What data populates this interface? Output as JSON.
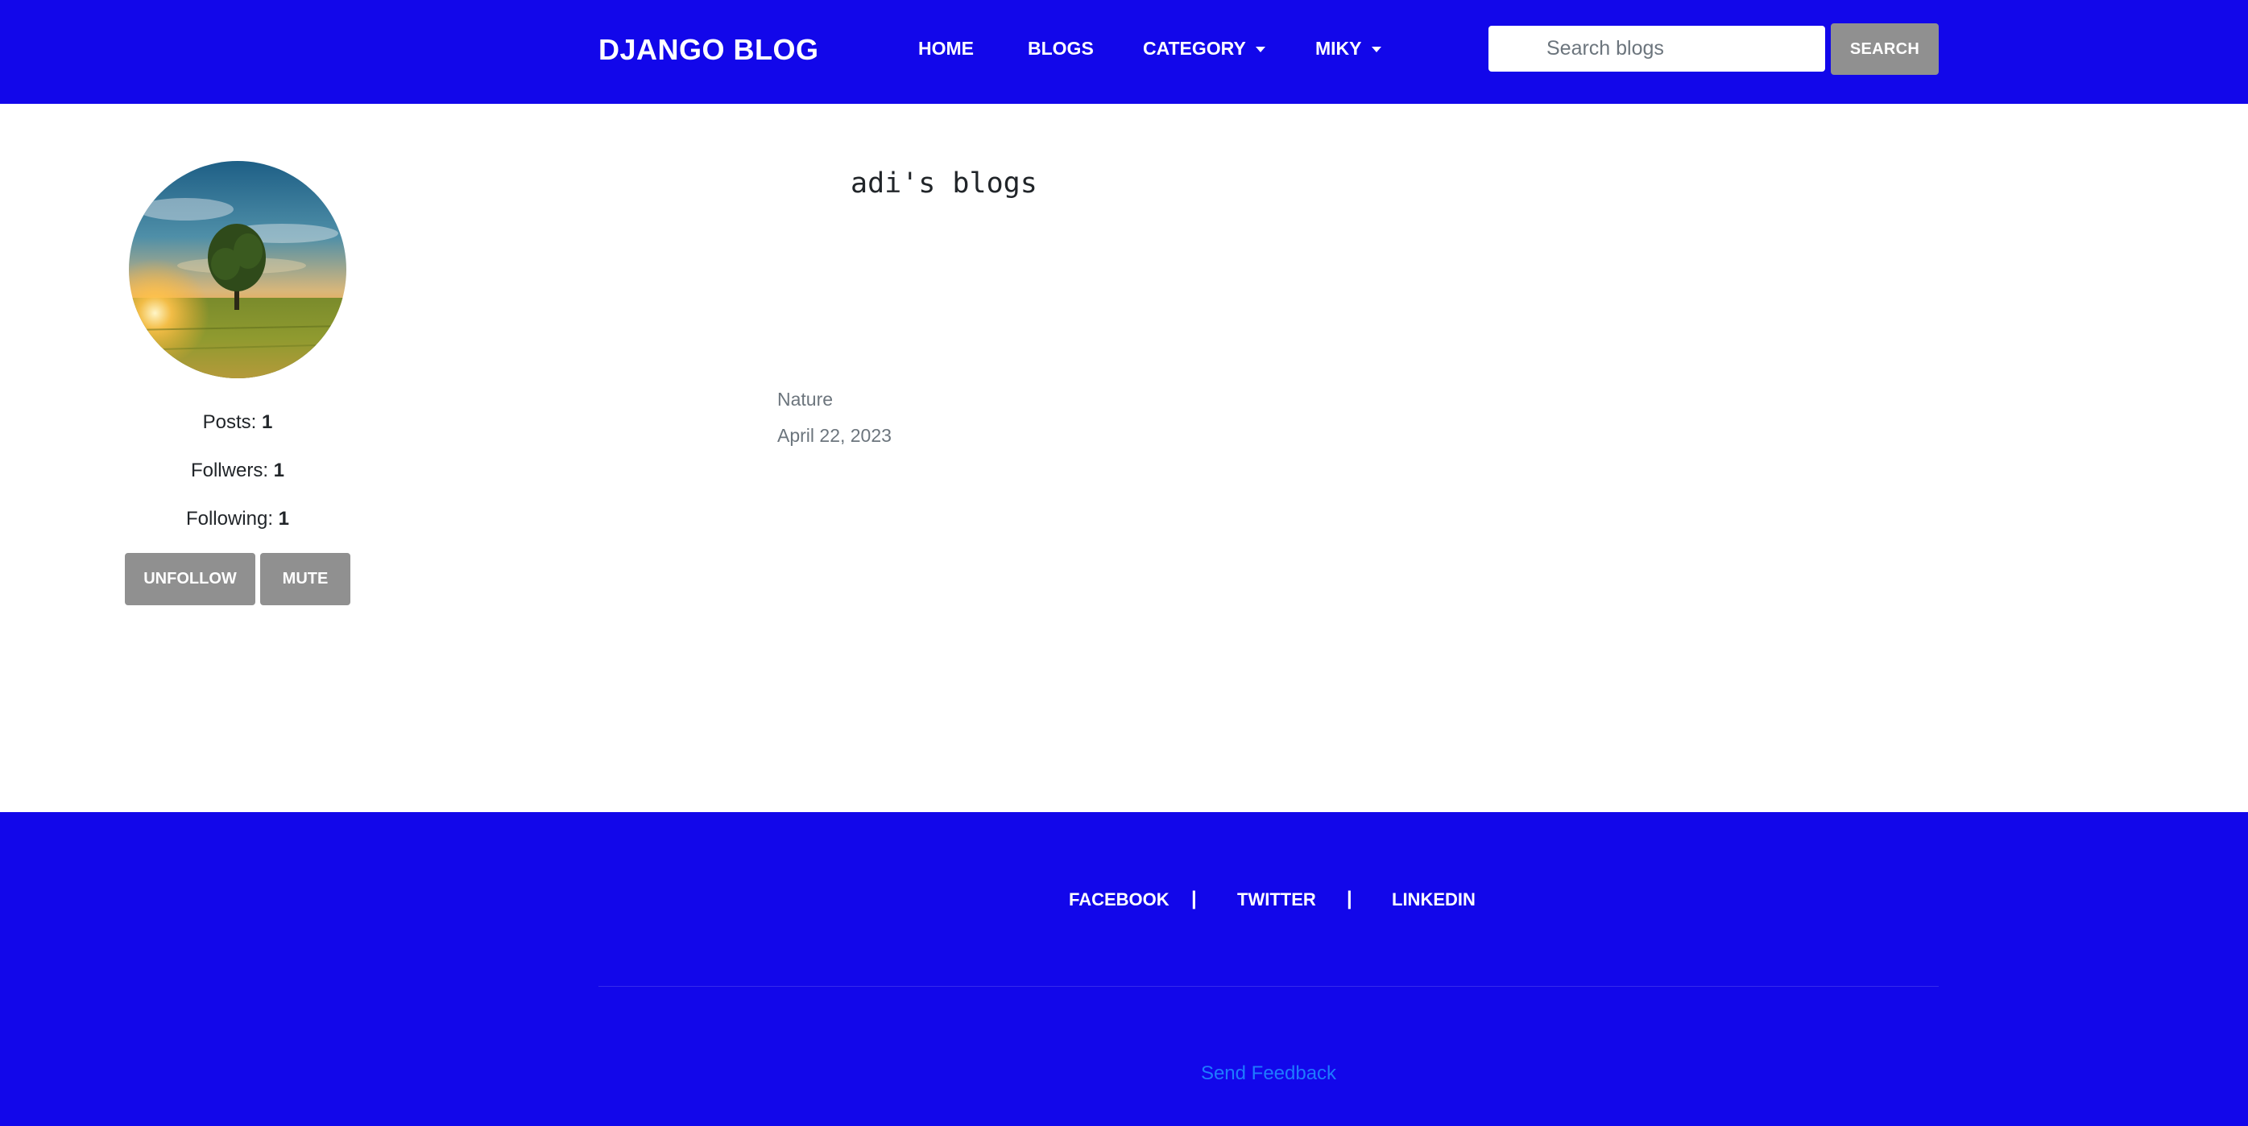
{
  "navbar": {
    "brand": "DJANGO BLOG",
    "items": [
      {
        "label": "HOME"
      },
      {
        "label": "BLOGS"
      },
      {
        "label": "CATEGORY",
        "dropdown": true
      },
      {
        "label": "MIKY",
        "dropdown": true
      }
    ],
    "search": {
      "placeholder": "Search blogs",
      "value": "",
      "button_label": "SEARCH"
    },
    "bg_color": "#1207ea"
  },
  "profile": {
    "avatar_description_icon": "landscape-photo",
    "posts_label": "Posts:",
    "posts_count": "1",
    "followers_label": "Follwers:",
    "followers_count": "1",
    "following_label": "Following:",
    "following_count": "1",
    "unfollow_label": "UNFOLLOW",
    "mute_label": "MUTE"
  },
  "main": {
    "title": "adi's blogs",
    "post": {
      "category": "Nature",
      "date": "April 22, 2023"
    }
  },
  "footer": {
    "links": [
      "FACEBOOK",
      "TWITTER",
      "LINKEDIN"
    ],
    "separator": "|",
    "feedback_label": "Send Feedback",
    "bg_color": "#1207ea",
    "feedback_color": "#1e7bff"
  }
}
